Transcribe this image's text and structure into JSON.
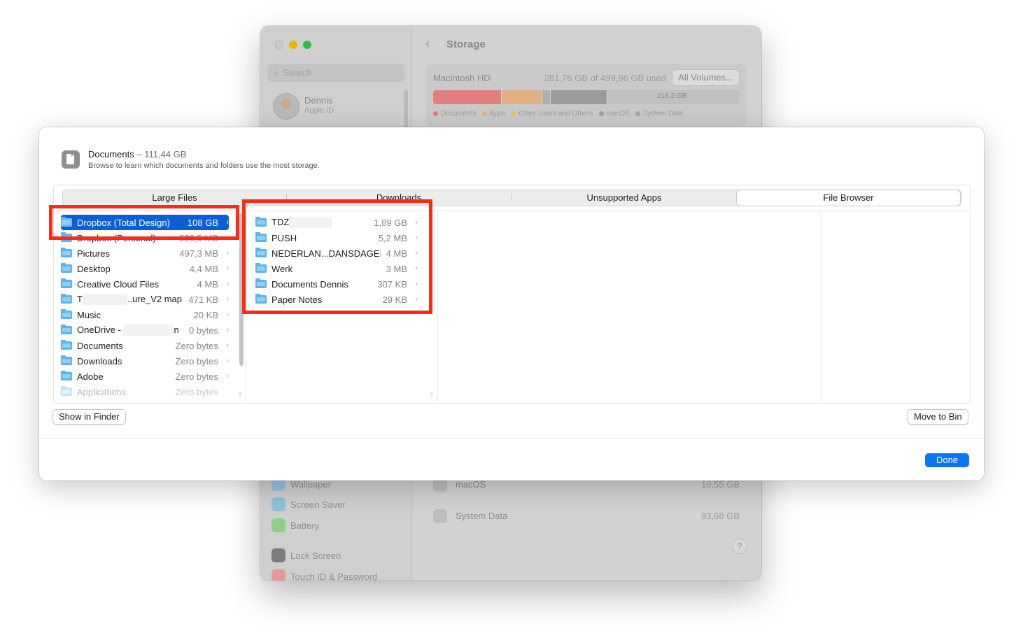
{
  "background_window": {
    "search_placeholder": "Search",
    "user": {
      "name": "Dennis",
      "subtitle": "Apple ID"
    },
    "title": "Storage",
    "disk": {
      "name": "Macintosh HD",
      "used_text": "281,76 GB of 499,96 GB used",
      "all_volumes_label": "All Volumes...",
      "free_label": "218,2 GB",
      "segments": [
        {
          "name": "Documents",
          "fraction": 0.222,
          "color": "#e0807d"
        },
        {
          "name": "Apps",
          "fraction": 0.13,
          "color": "#e2b083"
        },
        {
          "name": "Other Users and Others",
          "fraction": 0.025,
          "color": "#b0b0b0"
        },
        {
          "name": "macOS",
          "fraction": 0.183,
          "color": "#9b9b9b"
        }
      ],
      "legend": [
        {
          "label": "Documents",
          "color": "#e0807d"
        },
        {
          "label": "Apps",
          "color": "#e2b083"
        },
        {
          "label": "Other Users and Others",
          "color": "#e8c35a"
        },
        {
          "label": "macOS",
          "color": "#a0a0a0"
        },
        {
          "label": "System Data",
          "color": "#a8a8a8"
        }
      ]
    },
    "sidebar_items": [
      {
        "label": "Wallpaper",
        "icon": "wallpaper-icon",
        "color": "#9bc3e0"
      },
      {
        "label": "Screen Saver",
        "icon": "screen-saver-icon",
        "color": "#8fc2d8"
      },
      {
        "label": "Battery",
        "icon": "battery-icon",
        "color": "#8fcf84"
      },
      {
        "label": "Lock Screen",
        "icon": "lock-icon",
        "color": "#7c7c7c"
      },
      {
        "label": "Touch ID & Password",
        "icon": "fingerprint-icon",
        "color": "#e59a9a"
      }
    ],
    "rows": [
      {
        "name": "macOS",
        "size": "10,55 GB"
      },
      {
        "name": "System Data",
        "size": "93,68 GB"
      }
    ],
    "help_label": "?"
  },
  "sheet": {
    "title": "Documents",
    "title_size": "– 111,44 GB",
    "subtitle": "Browse to learn which documents and folders use the most storage.",
    "tabs": [
      "Large Files",
      "Downloads",
      "Unsupported Apps",
      "File Browser"
    ],
    "selected_tab": "File Browser",
    "column1": [
      {
        "name": "Dropbox (Total Design)",
        "size": "108 GB",
        "selected": true
      },
      {
        "name": "Dropbox (Personal)",
        "size": "520,5 MB"
      },
      {
        "name": "Pictures",
        "size": "497,3 MB"
      },
      {
        "name": "Desktop",
        "size": "4,4 MB"
      },
      {
        "name": "Creative Cloud Files",
        "size": "4 MB"
      },
      {
        "name_prefix": "T",
        "name_suffix": "..ure_V2 map",
        "size": "471 KB"
      },
      {
        "name": "Music",
        "size": "20 KB"
      },
      {
        "name_prefix": "OneDrive - ",
        "name_suffix": "n",
        "size": "0 bytes"
      },
      {
        "name": "Documents",
        "size": "Zero bytes"
      },
      {
        "name": "Downloads",
        "size": "Zero bytes"
      },
      {
        "name": "Adobe",
        "size": "Zero bytes"
      },
      {
        "name": "Applications",
        "size": "Zero bytes",
        "dim": true
      }
    ],
    "column2": [
      {
        "name_prefix": "TDZ",
        "size": "1,89 GB"
      },
      {
        "name": "PUSH",
        "size": "5,2 MB"
      },
      {
        "name": "NEDERLAN...DANSDAGEN",
        "size": "4 MB"
      },
      {
        "name": "Werk",
        "size": "3 MB"
      },
      {
        "name": "Documents Dennis",
        "size": "307 KB"
      },
      {
        "name": "Paper Notes",
        "size": "29 KB"
      }
    ],
    "chevron": "›",
    "show_in_finder_label": "Show in Finder",
    "move_to_bin_label": "Move to Bin",
    "done_label": "Done"
  }
}
